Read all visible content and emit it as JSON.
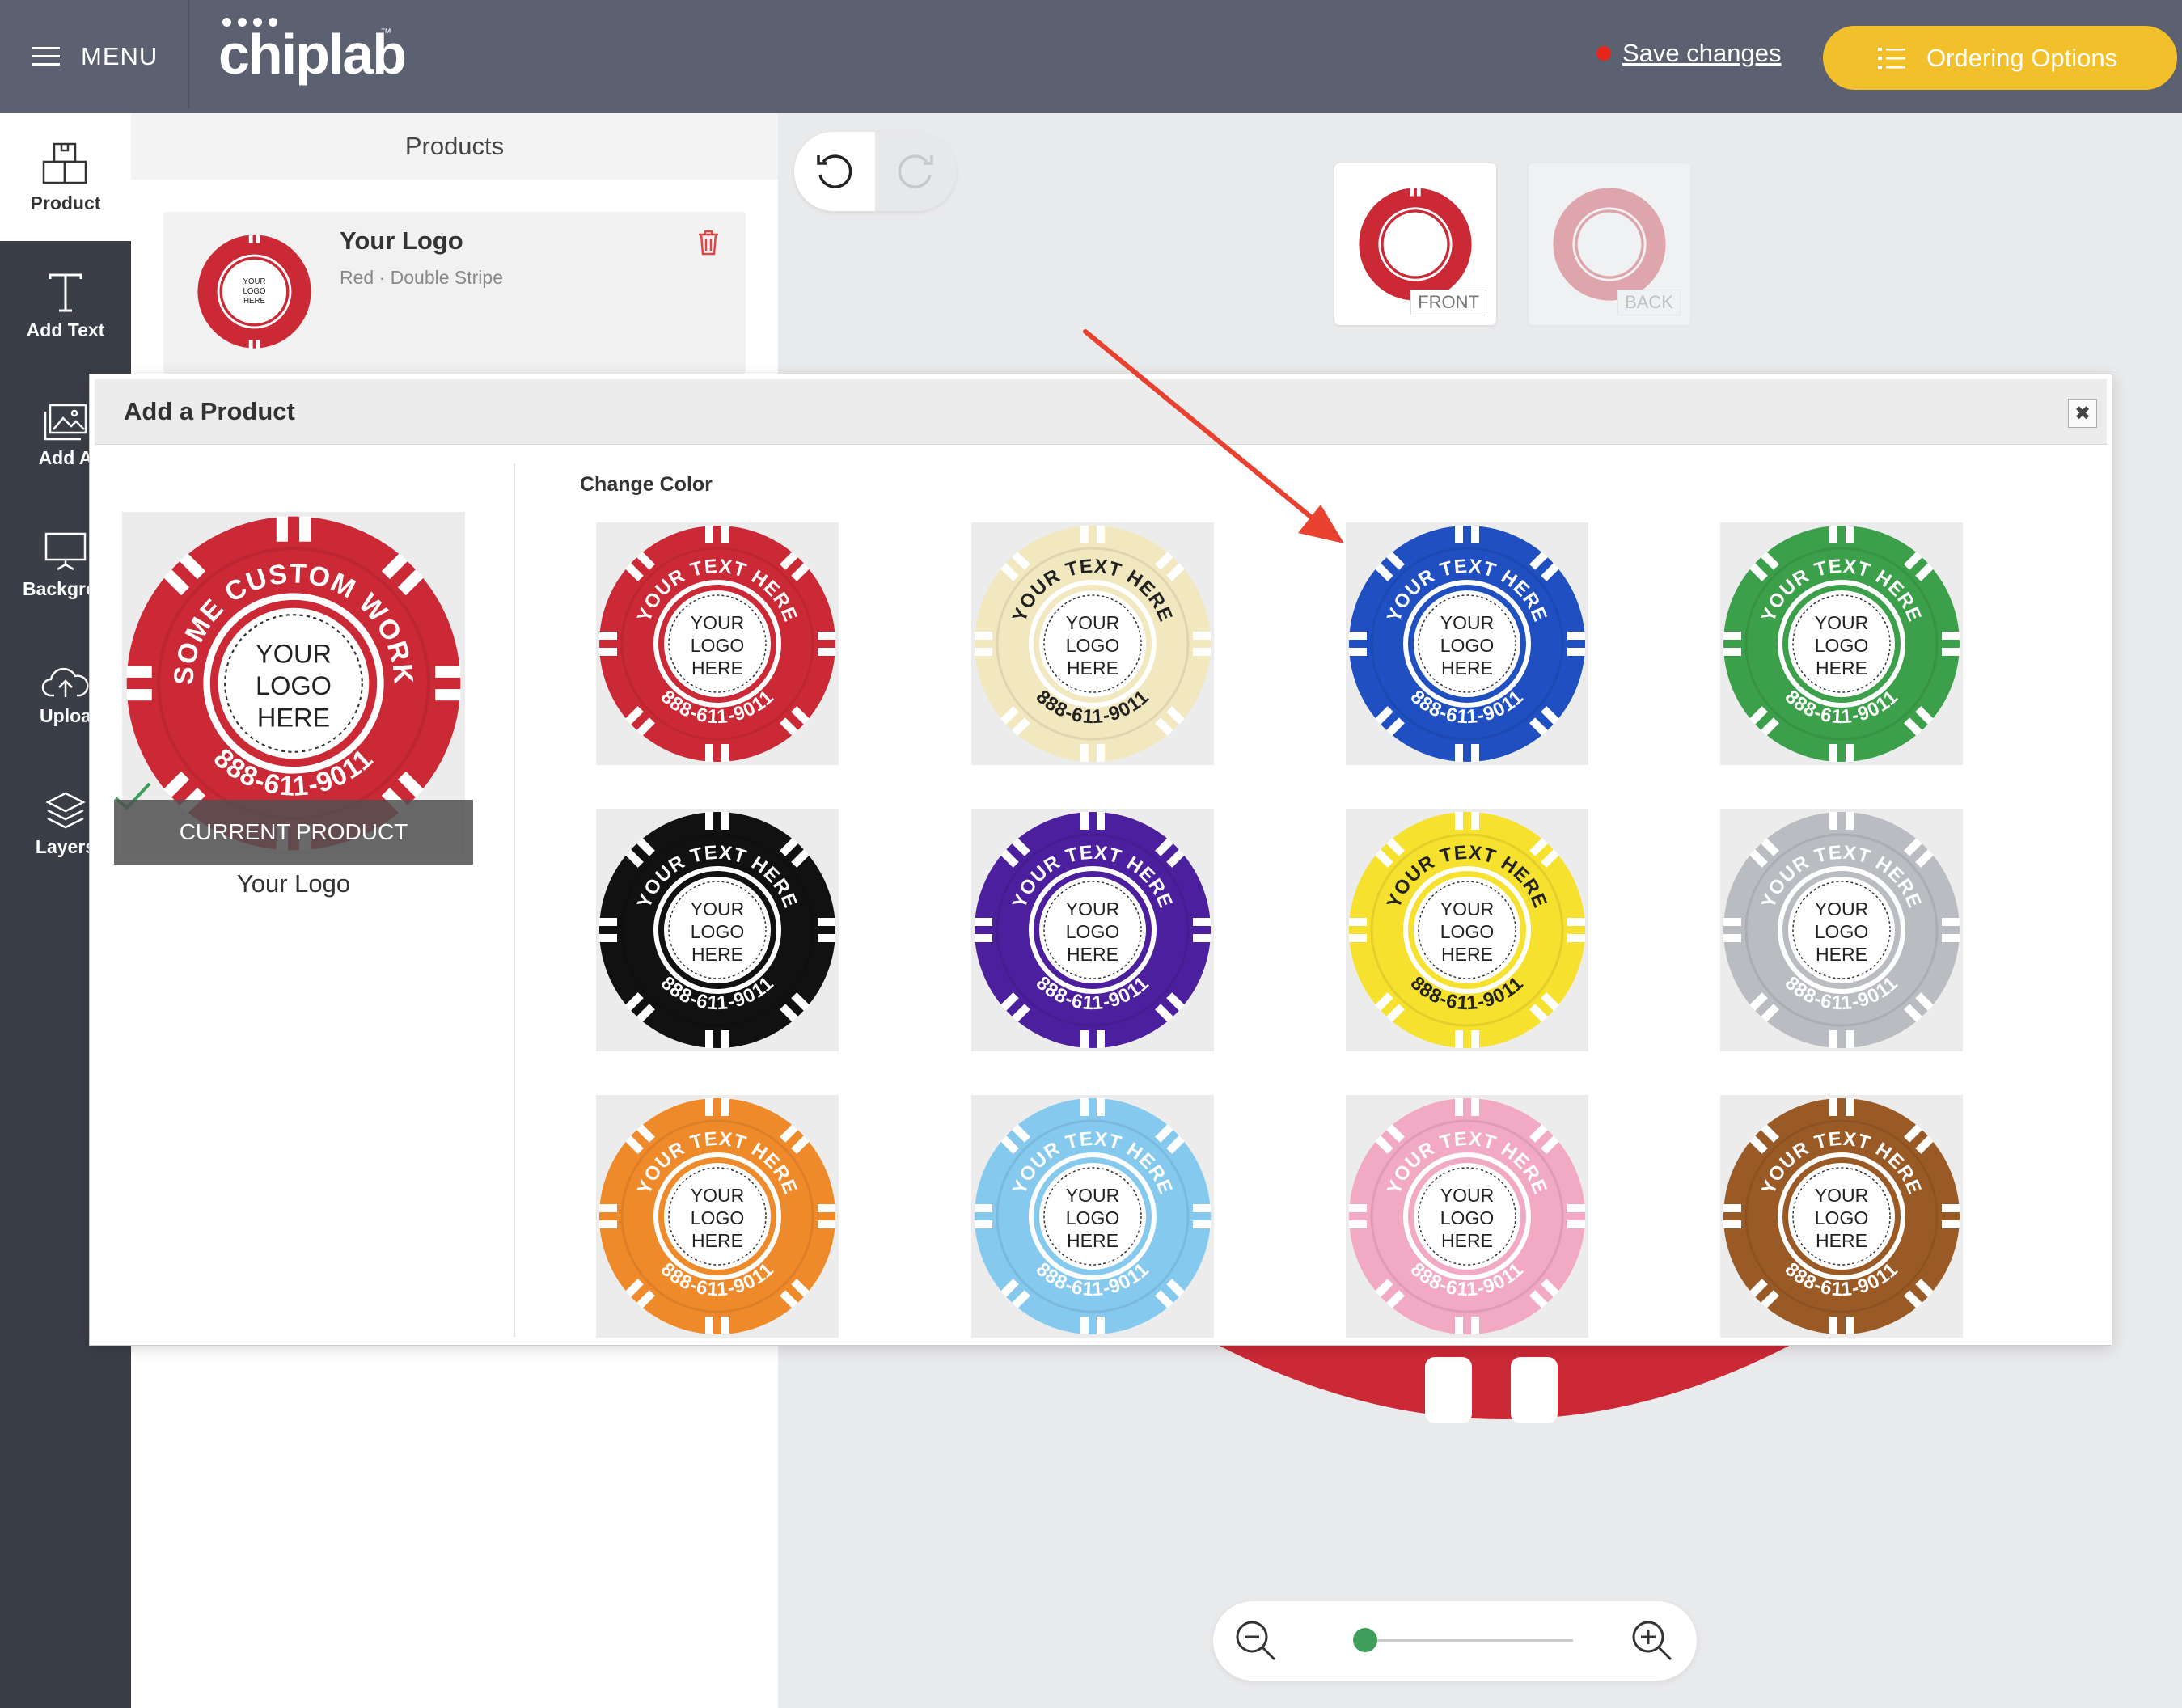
{
  "topbar": {
    "menu_label": "MENU",
    "logo_text": "chiplab",
    "logo_tm": "™",
    "save_label": "Save changes",
    "ordering_label": "Ordering Options",
    "save_dot_color": "#e8251a",
    "ordering_color": "#f1c02b"
  },
  "sidebar": {
    "items": [
      {
        "label": "Product",
        "icon": "package-icon"
      },
      {
        "label": "Add Text",
        "icon": "text-icon"
      },
      {
        "label": "Add A",
        "icon": "image-icon"
      },
      {
        "label": "Backgrou",
        "icon": "presentation-icon"
      },
      {
        "label": "Uploa",
        "icon": "cloud-upload-icon"
      },
      {
        "label": "Layers",
        "icon": "layers-icon"
      }
    ]
  },
  "products_panel": {
    "header": "Products",
    "card": {
      "name": "Your Logo",
      "sub": "Red · Double Stripe"
    }
  },
  "chip_text": {
    "top": "YOUR TEXT HERE",
    "center": [
      "YOUR",
      "LOGO",
      "HERE"
    ],
    "bottom": "888-611-9011",
    "current_top": "SOME CUSTOM WORK"
  },
  "sides": {
    "front": "FRONT",
    "back": "BACK"
  },
  "modal": {
    "title": "Add a Product",
    "close_glyph": "✖",
    "current_label": "CURRENT PRODUCT",
    "current_name": "Your Logo",
    "change_color_label": "Change Color",
    "colors": [
      {
        "name": "red",
        "fill": "#cc2936",
        "text": "#ffffff"
      },
      {
        "name": "ivory",
        "fill": "#f1e8bf",
        "text": "#222222"
      },
      {
        "name": "blue",
        "fill": "#1f4fc1",
        "text": "#ffffff"
      },
      {
        "name": "green",
        "fill": "#3c9f4a",
        "text": "#ffffff"
      },
      {
        "name": "black",
        "fill": "#111111",
        "text": "#ffffff"
      },
      {
        "name": "purple",
        "fill": "#4c1f9e",
        "text": "#ffffff"
      },
      {
        "name": "yellow",
        "fill": "#f5e12e",
        "text": "#222222"
      },
      {
        "name": "gray",
        "fill": "#b9bcc0",
        "text": "#ffffff"
      },
      {
        "name": "orange",
        "fill": "#ef8a2b",
        "text": "#ffffff"
      },
      {
        "name": "light-blue",
        "fill": "#86c9ee",
        "text": "#ffffff"
      },
      {
        "name": "pink",
        "fill": "#f1a9c4",
        "text": "#ffffff"
      },
      {
        "name": "brown",
        "fill": "#9a5a26",
        "text": "#ffffff"
      }
    ]
  },
  "zoom": {
    "level": 0.0
  },
  "annotation": {
    "arrow_color": "#e8412f"
  }
}
